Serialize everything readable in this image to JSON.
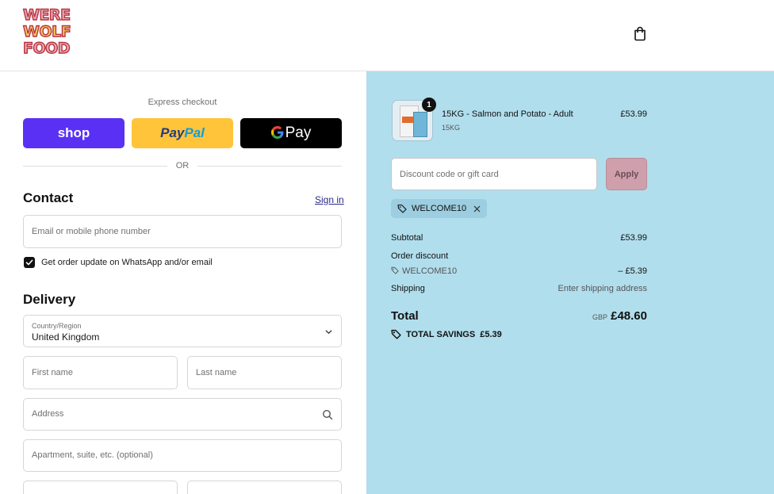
{
  "header": {
    "logo_lines": [
      "WERE",
      "WOLF",
      "FOOD"
    ],
    "cart_icon": "shopping-bag-icon"
  },
  "express": {
    "label": "Express checkout",
    "shop_label": "shop",
    "paypal_label_1": "Pay",
    "paypal_label_2": "Pal",
    "gpay_g": "G",
    "gpay_label": "Pay",
    "or_label": "OR"
  },
  "contact": {
    "title": "Contact",
    "signin_label": "Sign in",
    "email_placeholder": "Email or mobile phone number",
    "checkbox_label": "Get order update on WhatsApp and/or email",
    "checkbox_checked": true
  },
  "delivery": {
    "title": "Delivery",
    "country_label": "Country/Region",
    "country_value": "United Kingdom",
    "first_name_placeholder": "First name",
    "last_name_placeholder": "Last name",
    "address_placeholder": "Address",
    "apartment_placeholder": "Apartment, suite, etc. (optional)"
  },
  "order": {
    "item": {
      "quantity": "1",
      "name": "15KG - Salmon and Potato - Adult",
      "variant": "15KG",
      "price": "£53.99"
    },
    "discount_placeholder": "Discount code or gift card",
    "apply_label": "Apply",
    "applied_code": "WELCOME10",
    "subtotal_label": "Subtotal",
    "subtotal_value": "£53.99",
    "order_discount_label": "Order discount",
    "discount_code": "WELCOME10",
    "discount_value": "– £5.39",
    "shipping_label": "Shipping",
    "shipping_value": "Enter shipping address",
    "total_label": "Total",
    "total_currency": "GBP",
    "total_value": "£48.60",
    "savings_label": "TOTAL SAVINGS",
    "savings_value": "£5.39"
  },
  "colors": {
    "summary_bg": "#b1deed",
    "shop_pay": "#5a31f4",
    "paypal": "#ffc439",
    "apply_button": "#cf9fac"
  }
}
